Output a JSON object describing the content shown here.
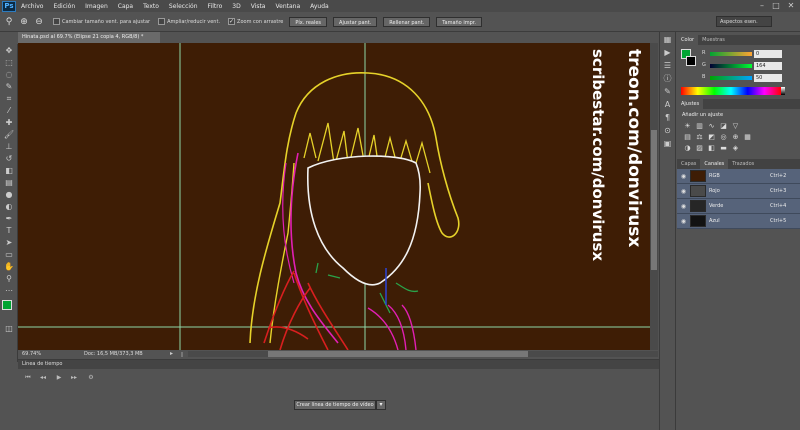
{
  "menubar": {
    "logo": "Ps",
    "items": [
      "Archivo",
      "Edición",
      "Imagen",
      "Capa",
      "Texto",
      "Selección",
      "Filtro",
      "3D",
      "Vista",
      "Ventana",
      "Ayuda"
    ]
  },
  "options": {
    "chk1": "Cambiar tamaño vent. para ajustar",
    "chk2": "Ampliar/reducir vent.",
    "chk3": "Zoom con arrastre",
    "btn1": "Píx. reales",
    "btn2": "Ajustar pant.",
    "btn3": "Rellenar pant.",
    "btn4": "Tamaño impr.",
    "workspace": "Aspectos esen."
  },
  "document": {
    "tab": "Hinata.psd al 69.7% (Elipse 21 copia 4, RGB/8) *",
    "watermark1": "treon.com/donvirusx",
    "watermark2": "scribestar.com/donvirusx"
  },
  "status": {
    "zoom": "69.74%",
    "doc": "Doc: 16,5 MB/373,3 MB"
  },
  "timeline": {
    "title": "Línea de tiempo",
    "button": "Crear línea de tiempo de vídeo"
  },
  "color_panel": {
    "tabs": [
      "Color",
      "Muestras"
    ],
    "r_label": "R",
    "g_label": "G",
    "b_label": "B",
    "r": "0",
    "g": "164",
    "b": "50",
    "fg_color": "#00a432"
  },
  "adjust_panel": {
    "tabs": [
      "Ajustes"
    ],
    "heading": "Añadir un ajuste"
  },
  "channels_panel": {
    "tabs": [
      "Capas",
      "Canales",
      "Trazados"
    ],
    "rows": [
      {
        "name": "RGB",
        "shortcut": "Ctrl+2",
        "thumb": "#3e1d05"
      },
      {
        "name": "Rojo",
        "shortcut": "Ctrl+3",
        "thumb": "#4a4a4a"
      },
      {
        "name": "Verde",
        "shortcut": "Ctrl+4",
        "thumb": "#262626"
      },
      {
        "name": "Azul",
        "shortcut": "Ctrl+5",
        "thumb": "#121212"
      }
    ]
  }
}
